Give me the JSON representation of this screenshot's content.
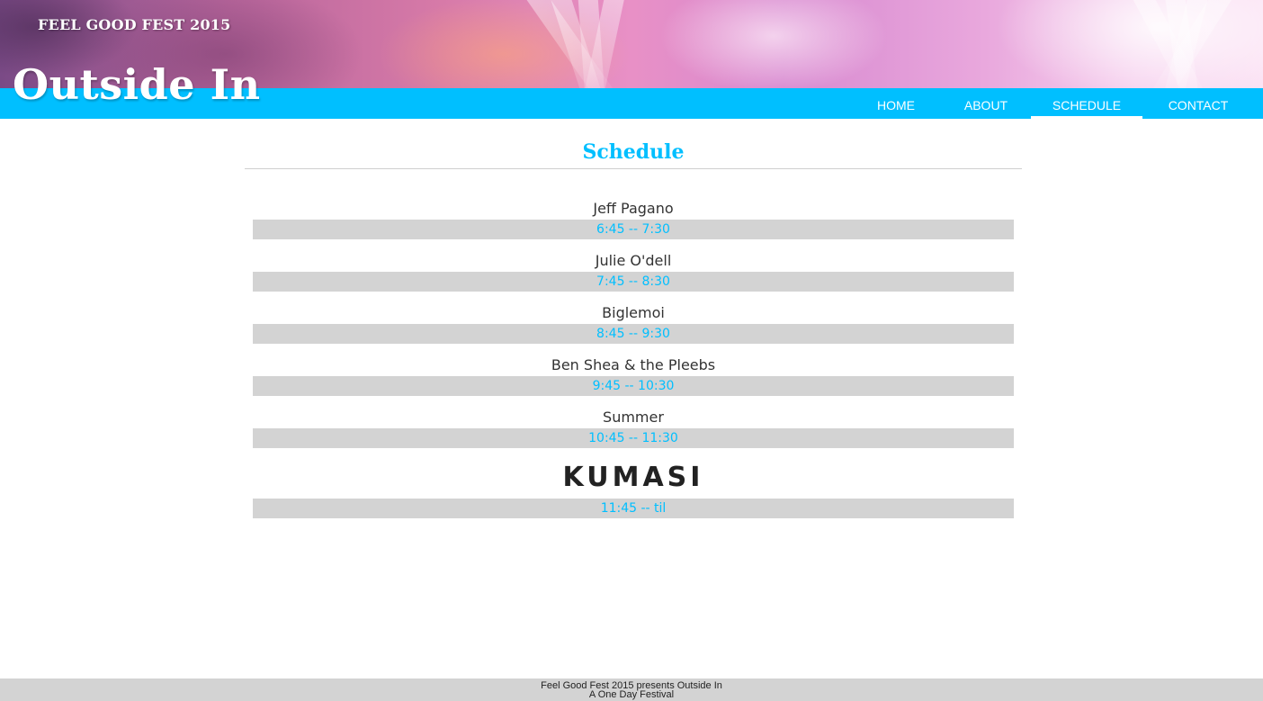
{
  "header": {
    "site_tag": "FEEL GOOD FEST 2015",
    "site_title": "Outside In",
    "accent_color": "#00bfff"
  },
  "nav": {
    "items": [
      {
        "label": "HOME",
        "active": false
      },
      {
        "label": "ABOUT",
        "active": false
      },
      {
        "label": "SCHEDULE",
        "active": true
      },
      {
        "label": "CONTACT",
        "active": false
      }
    ]
  },
  "main": {
    "title": "Schedule",
    "schedule": [
      {
        "artist": "Jeff Pagano",
        "time": "6:45 -- 7:30"
      },
      {
        "artist": "Julie O'dell",
        "time": "7:45 -- 8:30"
      },
      {
        "artist": "Biglemoi",
        "time": "8:45 -- 9:30"
      },
      {
        "artist": "Ben Shea & the Pleebs",
        "time": "9:45 -- 10:30"
      },
      {
        "artist": "Summer",
        "time": "10:45 -- 11:30"
      },
      {
        "artist": "KUMASI",
        "time": "11:45 -- til",
        "headliner": true
      }
    ]
  },
  "footer": {
    "line1": "Feel Good Fest 2015 presents Outside In",
    "line2": "A One Day Festival"
  }
}
